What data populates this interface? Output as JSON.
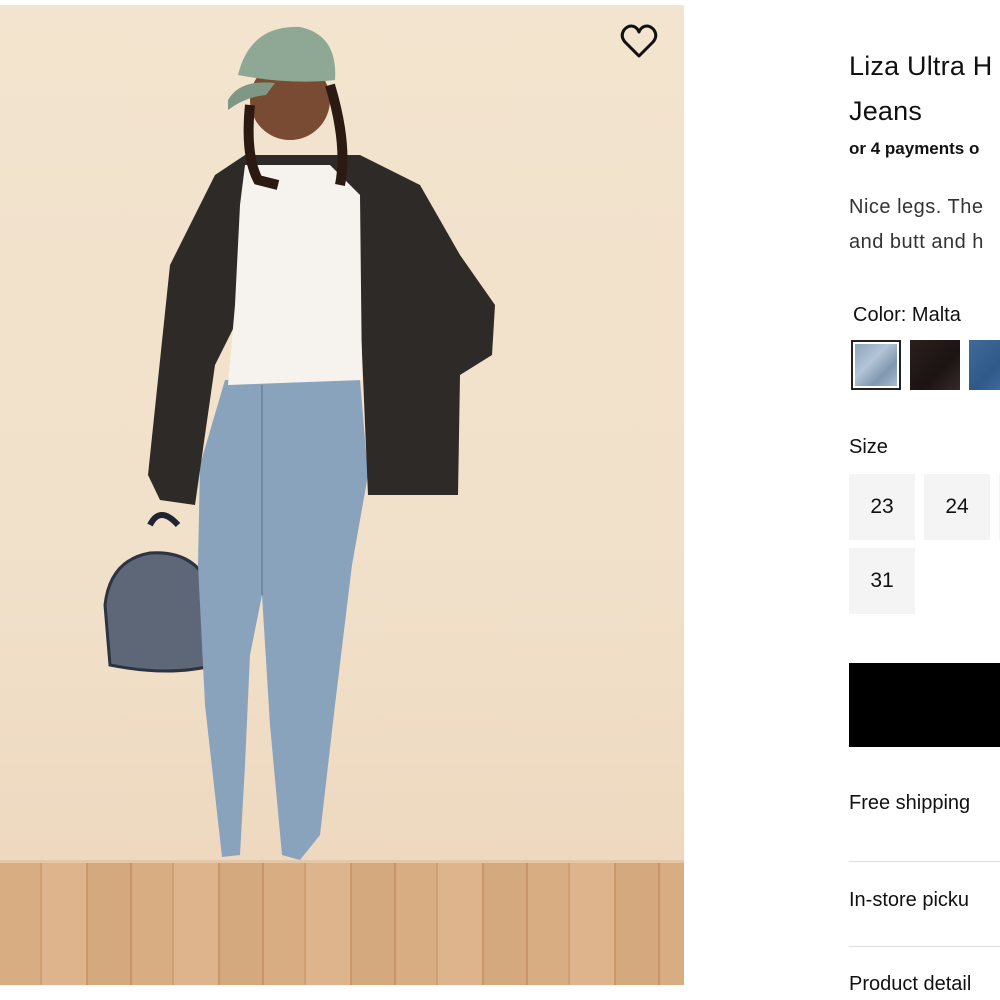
{
  "product": {
    "title": "Liza Ultra H\nJeans",
    "payments": "or 4 payments o",
    "description": "Nice legs. The\nand butt and h"
  },
  "color": {
    "label": "Color: Malta",
    "swatches": [
      "Malta",
      "Black",
      "Dark blue"
    ]
  },
  "size": {
    "label": "Size",
    "options": [
      "23",
      "24",
      "31"
    ]
  },
  "shipping": {
    "label": "Free shipping"
  },
  "pickup": {
    "label": "In-store picku"
  },
  "details": {
    "label": "Product detail"
  },
  "icons": {
    "favorite": "heart-icon"
  }
}
